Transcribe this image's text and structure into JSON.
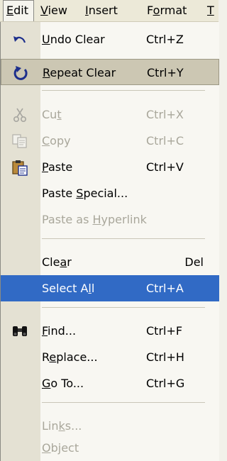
{
  "menubar": {
    "edit": {
      "pre": "",
      "key": "E",
      "post": "dit"
    },
    "view": {
      "pre": "",
      "key": "V",
      "post": "iew"
    },
    "insert": {
      "pre": "",
      "key": "I",
      "post": "nsert"
    },
    "format": {
      "pre": "F",
      "key": "o",
      "post": "rmat"
    },
    "tools": {
      "pre": "",
      "key": "T",
      "post": ""
    }
  },
  "menu": {
    "undo": {
      "pre": "",
      "key": "U",
      "post": "ndo Clear",
      "shortcut": "Ctrl+Z"
    },
    "repeat": {
      "pre": "",
      "key": "R",
      "post": "epeat Clear",
      "shortcut": "Ctrl+Y"
    },
    "cut": {
      "pre": "Cu",
      "key": "t",
      "post": "",
      "shortcut": "Ctrl+X"
    },
    "copy": {
      "pre": "",
      "key": "C",
      "post": "opy",
      "shortcut": "Ctrl+C"
    },
    "paste": {
      "pre": "",
      "key": "P",
      "post": "aste",
      "shortcut": "Ctrl+V"
    },
    "paste_special": {
      "pre": "Paste ",
      "key": "S",
      "post": "pecial..."
    },
    "paste_hyperlink": {
      "pre": "Paste as ",
      "key": "H",
      "post": "yperlink"
    },
    "clear": {
      "pre": "Cle",
      "key": "a",
      "post": "r",
      "shortcut": "Del"
    },
    "select_all": {
      "pre": "Select A",
      "key": "l",
      "post": "l",
      "shortcut": "Ctrl+A"
    },
    "find": {
      "pre": "",
      "key": "F",
      "post": "ind...",
      "shortcut": "Ctrl+F"
    },
    "replace": {
      "pre": "R",
      "key": "e",
      "post": "place...",
      "shortcut": "Ctrl+H"
    },
    "goto": {
      "pre": "",
      "key": "G",
      "post": "o To...",
      "shortcut": "Ctrl+G"
    },
    "links": {
      "pre": "Lin",
      "key": "k",
      "post": "s..."
    },
    "object": {
      "pre": "",
      "key": "O",
      "post": "bject"
    }
  },
  "colors": {
    "selection": "#316ac5",
    "hover_box": "#ccc7b3",
    "icon_strip": "#e4e1d3",
    "disabled_text": "#a9a79b"
  }
}
